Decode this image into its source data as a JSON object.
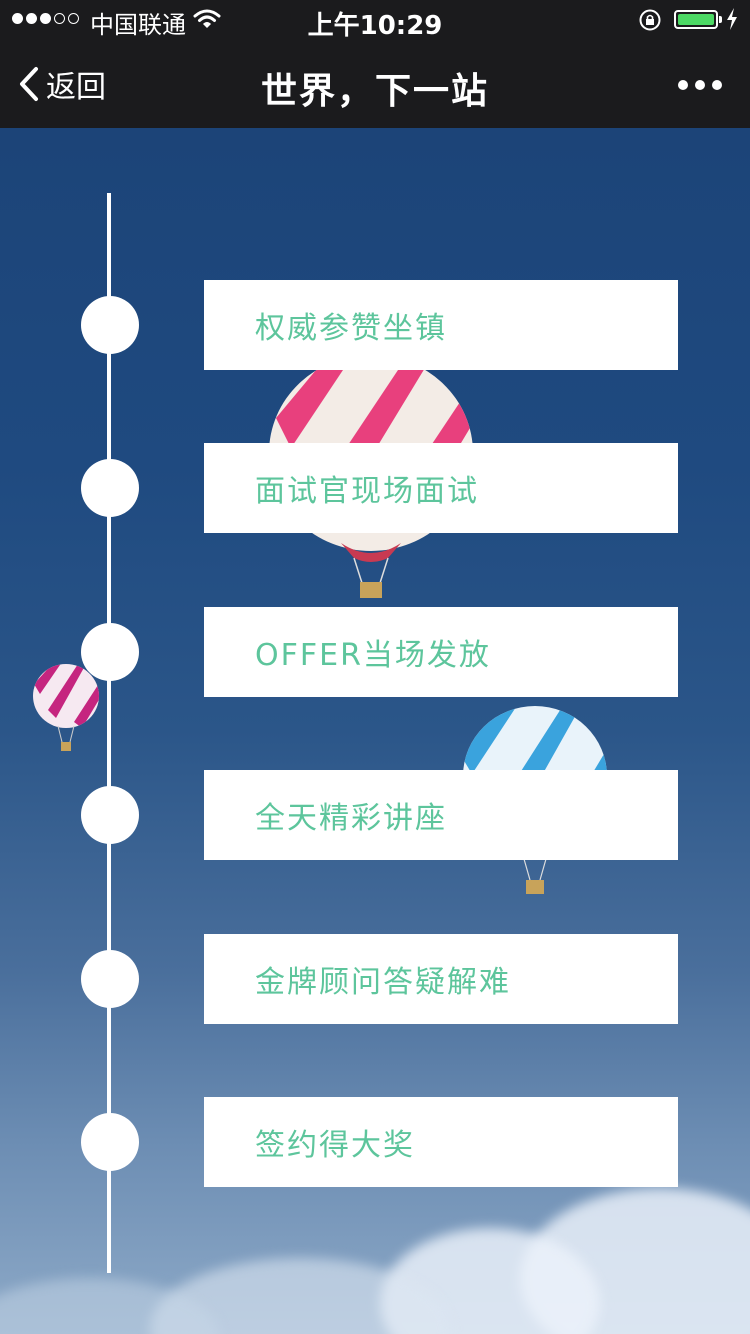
{
  "status_bar": {
    "carrier": "中国联通",
    "time": "上午10:29",
    "signal_bars_filled": 3,
    "signal_bars_total": 5,
    "battery_level": 0.9
  },
  "nav": {
    "back_label": "返回",
    "title": "世界，下一站",
    "more_icon": "more-dots-icon"
  },
  "timeline": {
    "items": [
      {
        "label": "权威参赞坐镇"
      },
      {
        "label": "面试官现场面试"
      },
      {
        "label": "OFFER当场发放"
      },
      {
        "label": "全天精彩讲座"
      },
      {
        "label": "金牌顾问答疑解难"
      },
      {
        "label": "签约得大奖"
      }
    ]
  },
  "colors": {
    "nav_bg": "#1b1b1d",
    "card_text": "#5dc59c",
    "battery": "#4cd964",
    "sky_top": "#1c4478"
  }
}
